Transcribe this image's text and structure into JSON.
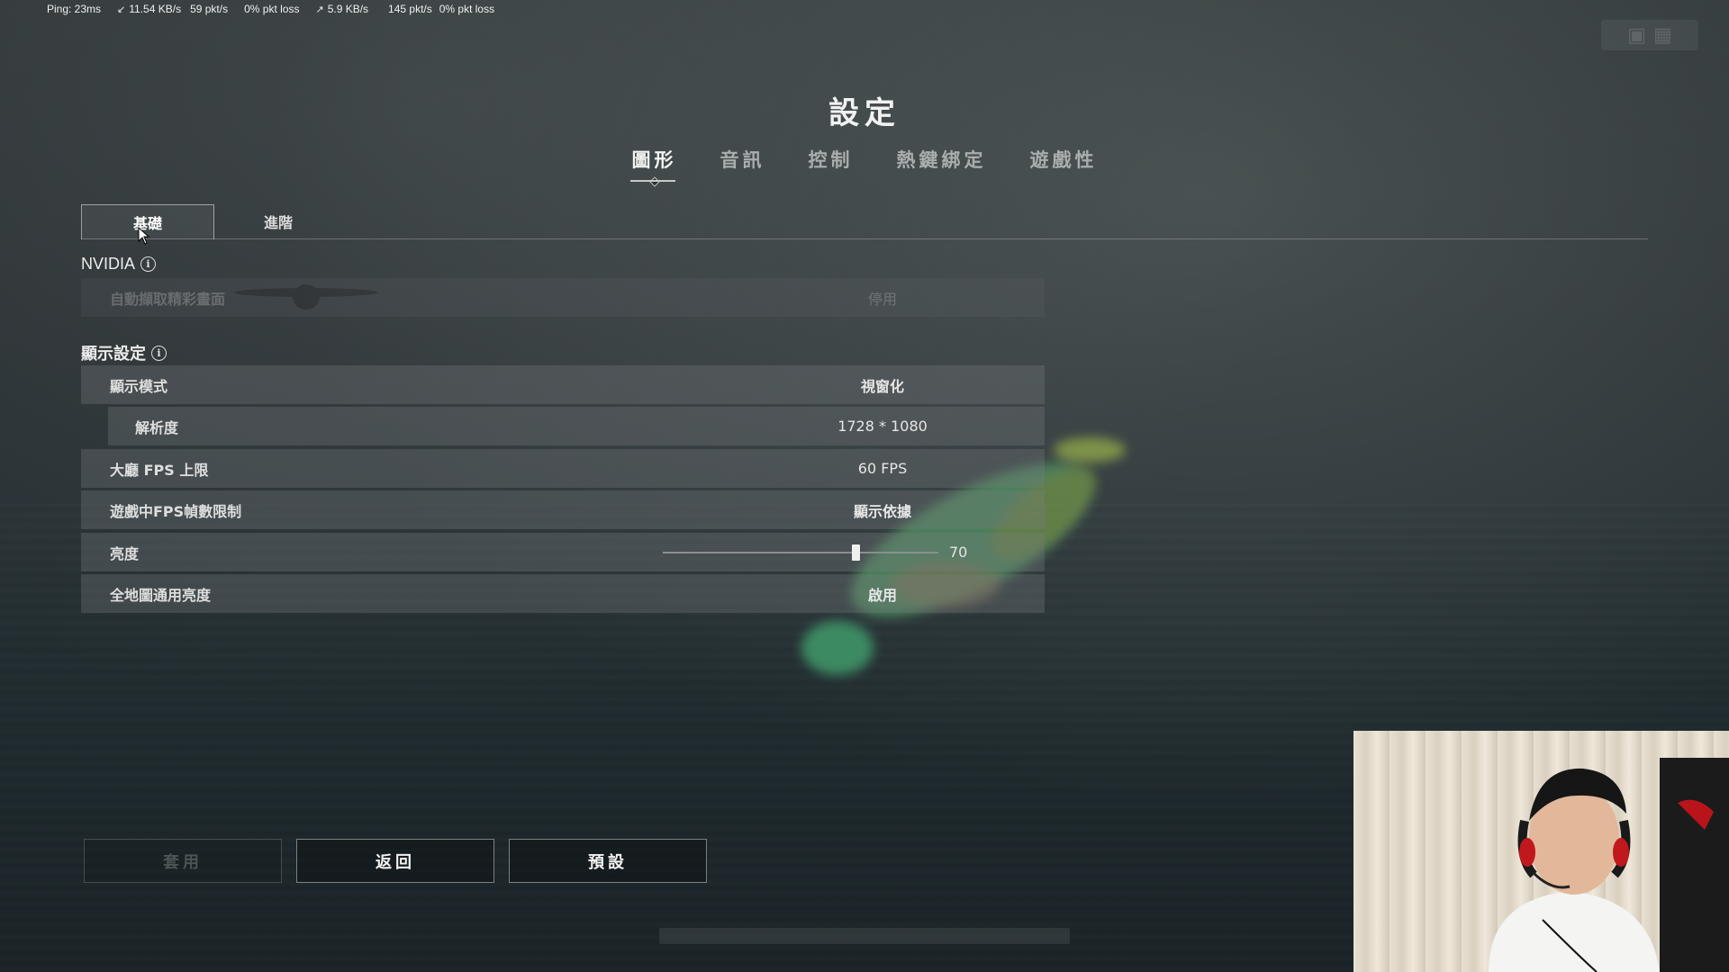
{
  "netstats": {
    "ping": "Ping: 23ms",
    "down_rate": "11.54 KB/s",
    "down_pkts": "59 pkt/s",
    "down_loss": "0% pkt loss",
    "up_rate": "5.9 KB/s",
    "up_pkts": "145 pkt/s",
    "up_loss": "0% pkt loss"
  },
  "title": "設定",
  "main_tabs": [
    {
      "label": "圖形",
      "active": true
    },
    {
      "label": "音訊",
      "active": false
    },
    {
      "label": "控制",
      "active": false
    },
    {
      "label": "熱鍵綁定",
      "active": false
    },
    {
      "label": "遊戲性",
      "active": false
    }
  ],
  "sub_tabs": [
    {
      "label": "基礎",
      "active": true
    },
    {
      "label": "進階",
      "active": false
    }
  ],
  "nvidia": {
    "heading": "NVIDIA",
    "rows": [
      {
        "label": "自動擷取精彩畫面",
        "value": "停用",
        "disabled": true
      }
    ]
  },
  "display": {
    "heading": "顯示設定",
    "rows": [
      {
        "label": "顯示模式",
        "value": "視窗化"
      },
      {
        "label": "解析度",
        "value": "1728 * 1080"
      },
      {
        "label": "大廳 FPS 上限",
        "value": "60 FPS"
      },
      {
        "label": "遊戲中FPS幀數限制",
        "value": "顯示依據"
      },
      {
        "label": "亮度",
        "value": "70"
      },
      {
        "label": "全地圖通用亮度",
        "value": "啟用"
      }
    ]
  },
  "brightness": {
    "value": 70,
    "min": 0,
    "max": 100
  },
  "buttons": {
    "apply": "套用",
    "back": "返回",
    "default": "預設"
  },
  "colors": {
    "row_bg": "#5a5f62",
    "text": "#dedede",
    "accent": "#f2f2f2"
  }
}
